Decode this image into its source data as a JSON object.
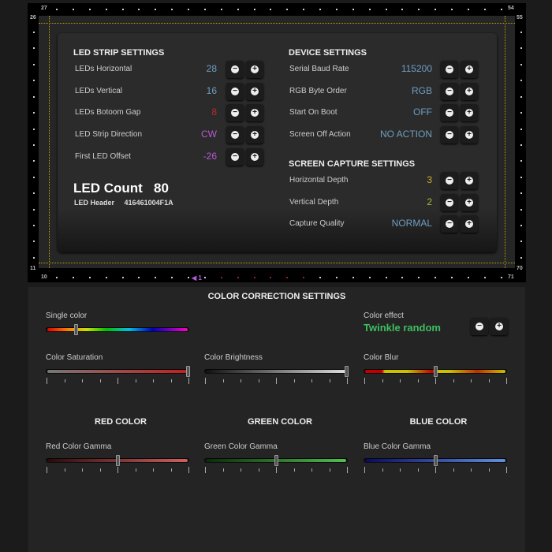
{
  "frame": {
    "corner_numbers": {
      "top_left": "27",
      "top_right": "54",
      "left_top": "26",
      "left_bottom": "11",
      "bottom_left": "10",
      "bottom_right": "71",
      "right_top": "55",
      "right_bottom": "70"
    },
    "first_led_marker": "◀ 1",
    "guide_color": "#b8a600"
  },
  "led_strip": {
    "title": "LED STRIP SETTINGS",
    "rows": [
      {
        "label": "LEDs Horizontal",
        "value": "28",
        "color": "#6f9ec0"
      },
      {
        "label": "LEDs Vertical",
        "value": "16",
        "color": "#6f9ec0"
      },
      {
        "label": "LEDs Botoom Gap",
        "value": "8",
        "color": "#c0282a"
      },
      {
        "label": "LED Strip Direction",
        "value": "CW",
        "color": "#b45cd6"
      },
      {
        "label": "First LED Offset",
        "value": "-26",
        "color": "#b45cd6"
      }
    ],
    "led_count_label": "LED Count",
    "led_count": "80",
    "led_header_label": "LED Header",
    "led_header": "416461004F1A"
  },
  "device": {
    "title": "DEVICE SETTINGS",
    "rows": [
      {
        "label": "Serial Baud Rate",
        "value": "115200",
        "color": "#6f9ec0"
      },
      {
        "label": "RGB Byte Order",
        "value": "RGB",
        "color": "#6f9ec0"
      },
      {
        "label": "Start On Boot",
        "value": "OFF",
        "color": "#6f9ec0"
      },
      {
        "label": "Screen Off Action",
        "value": "NO ACTION",
        "color": "#6f9ec0"
      }
    ]
  },
  "capture": {
    "title": "SCREEN CAPTURE SETTINGS",
    "rows": [
      {
        "label": "Horizontal Depth",
        "value": "3",
        "color": "#c9b030"
      },
      {
        "label": "Vertical Depth",
        "value": "2",
        "color": "#a8b830"
      },
      {
        "label": "Capture Quality",
        "value": "NORMAL",
        "color": "#6f9ec0"
      }
    ]
  },
  "color_correction": {
    "title": "COLOR CORRECTION SETTINGS",
    "single_color": {
      "label": "Single color",
      "value_fraction": 0.2
    },
    "color_effect": {
      "label": "Color effect",
      "value": "Twinkle random",
      "color": "#3cbf5f"
    },
    "saturation": {
      "label": "Color Saturation",
      "value_fraction": 1.0
    },
    "brightness": {
      "label": "Color Brightness",
      "value_fraction": 1.0
    },
    "blur": {
      "label": "Color Blur",
      "value_fraction": 0.5
    },
    "red": {
      "title": "RED COLOR",
      "label": "Red Color Gamma",
      "value_fraction": 0.5
    },
    "green": {
      "title": "GREEN COLOR",
      "label": "Green Color Gamma",
      "value_fraction": 0.5
    },
    "blue": {
      "title": "BLUE COLOR",
      "label": "Blue Color Gamma",
      "value_fraction": 0.5
    }
  },
  "icons": {
    "minus": "minus-circle-icon",
    "plus": "plus-circle-icon"
  }
}
